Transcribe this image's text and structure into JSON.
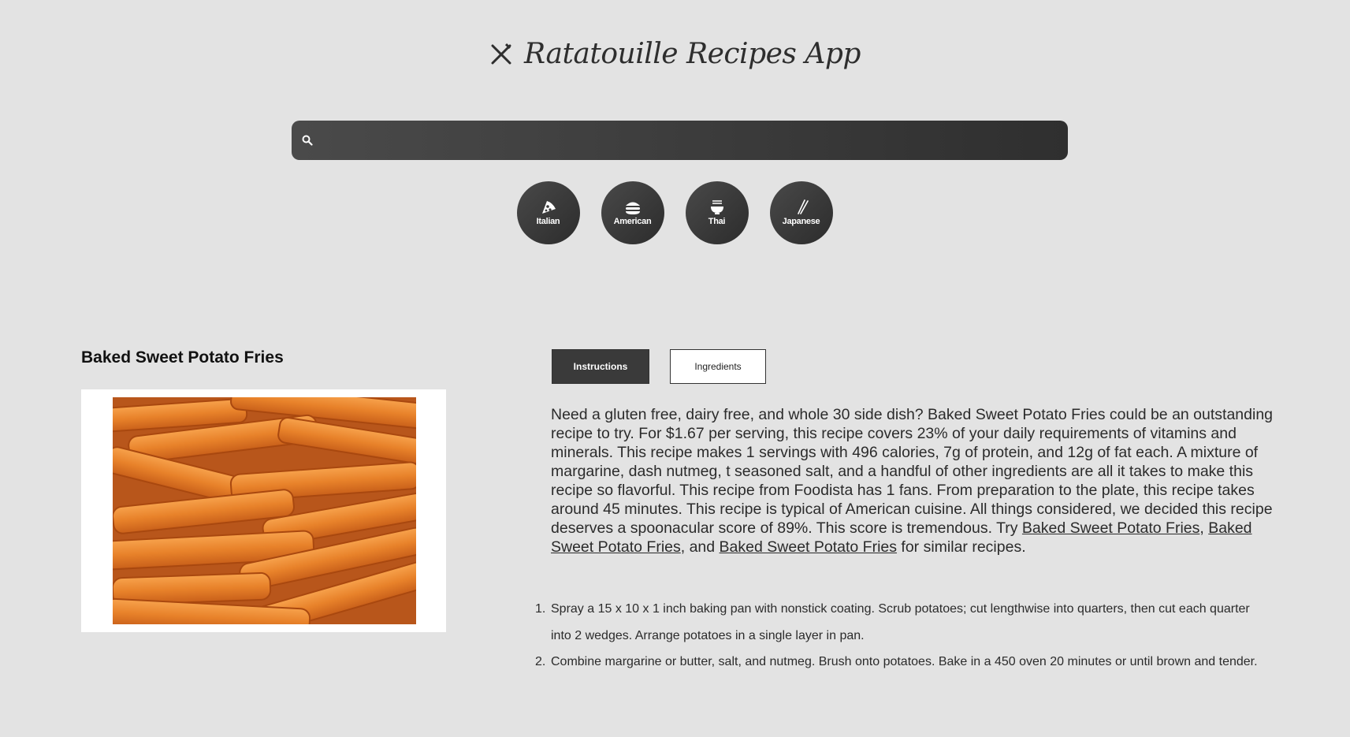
{
  "header": {
    "logo_icon": "fork-knife-icon",
    "title": "Ratatouille Recipes App"
  },
  "search": {
    "icon": "search-icon",
    "value": "",
    "placeholder": ""
  },
  "cuisines": [
    {
      "label": "Italian",
      "icon": "pizza-icon"
    },
    {
      "label": "American",
      "icon": "burger-icon"
    },
    {
      "label": "Thai",
      "icon": "noodle-bowl-icon"
    },
    {
      "label": "Japanese",
      "icon": "chopsticks-icon"
    }
  ],
  "recipe": {
    "title": "Baked Sweet Potato Fries",
    "image_alt": "Baked Sweet Potato Fries"
  },
  "tabs": {
    "instructions": "Instructions",
    "ingredients": "Ingredients",
    "active": "instructions"
  },
  "summary": {
    "text": "Need a gluten free, dairy free, and whole 30 side dish? Baked Sweet Potato Fries could be an outstanding recipe to try. For $1.67 per serving, this recipe covers 23% of your daily requirements of vitamins and minerals. This recipe makes 1 servings with 496 calories, 7g of protein, and 12g of fat each. A mixture of margarine, dash nutmeg, t seasoned salt, and a handful of other ingredients are all it takes to make this recipe so flavorful. This recipe from Foodista has 1 fans. From preparation to the plate, this recipe takes around 45 minutes. This recipe is typical of American cuisine. All things considered, we decided this recipe deserves a spoonacular score of 89%. This score is tremendous. Try ",
    "link1": "Baked Sweet Potato Fries",
    "sep1": ", ",
    "link2": "Baked Sweet Potato Fries",
    "sep2": ", and ",
    "link3": "Baked Sweet Potato Fries",
    "tail": " for similar recipes."
  },
  "steps": [
    {
      "number": "1.",
      "text": "Spray a 15 x 10 x 1 inch baking pan with nonstick coating. Scrub potatoes; cut lengthwise into quarters, then cut each quarter into 2 wedges. Arrange potatoes in a single layer in pan."
    },
    {
      "number": "2.",
      "text": "Combine margarine or butter, salt, and nutmeg. Brush onto potatoes. Bake in a 450 oven 20 minutes or until brown and tender."
    }
  ],
  "colors": {
    "background": "#e3e3e3",
    "dark": "#3a3a3a",
    "fries": "#e8822a"
  }
}
